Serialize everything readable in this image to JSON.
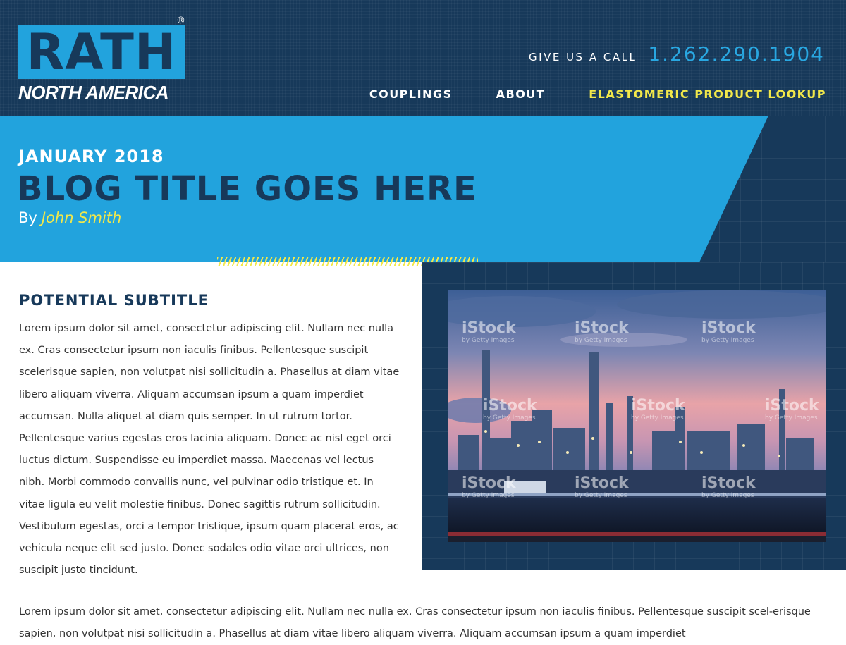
{
  "brand": {
    "logo_text": "RATH",
    "logo_sub": "NORTH AMERICA",
    "registered": "®"
  },
  "contact": {
    "label": "GIVE US A CALL",
    "phone": "1.262.290.1904"
  },
  "nav": {
    "items": [
      "COUPLINGS",
      "ABOUT",
      "ELASTOMERIC PRODUCT LOOKUP"
    ]
  },
  "hero": {
    "date": "JANUARY 2018",
    "title": "BLOG TITLE GOES HERE",
    "by_label": "By",
    "author": "John Smith"
  },
  "article": {
    "subtitle": "POTENTIAL SUBTITLE",
    "paragraph1": "Lorem ipsum dolor sit amet, consectetur adipiscing elit. Nullam nec nulla ex. Cras consectetur ipsum non iaculis finibus. Pellentesque suscipit scelerisque sapien, non volutpat nisi sollicitudin a. Phasellus at diam vitae libero aliquam viverra. Aliquam accumsan ipsum a quam imperdiet accumsan. Nulla aliquet at diam quis semper. In ut rutrum tortor. Pellentesque varius egestas eros lacinia aliquam. Donec ac nisl eget orci luctus dictum. Suspendisse eu imperdiet massa. Maecenas vel lectus nibh. Morbi commodo convallis nunc, vel pulvinar odio tristique et. In vitae ligula eu velit molestie finibus. Donec sagittis rutrum sollicitudin. Vestibulum egestas, orci a tempor tristique, ipsum quam placerat eros, ac vehicula neque elit sed justo. Donec sodales odio vitae orci ultrices, non suscipit justo tincidunt.",
    "paragraph2": "Lorem ipsum dolor sit amet, consectetur adipiscing elit. Nullam nec nulla ex. Cras consectetur ipsum non iaculis finibus. Pellentesque suscipit scel-erisque sapien, non volutpat nisi sollicitudin a. Phasellus at diam vitae libero aliquam viverra. Aliquam accumsan ipsum a quam imperdiet"
  },
  "photo": {
    "watermark": "iStock",
    "watermark_sub": "by Getty Images"
  },
  "colors": {
    "navy": "#17395a",
    "blue": "#22a3dd",
    "yellow": "#f2e84a"
  }
}
